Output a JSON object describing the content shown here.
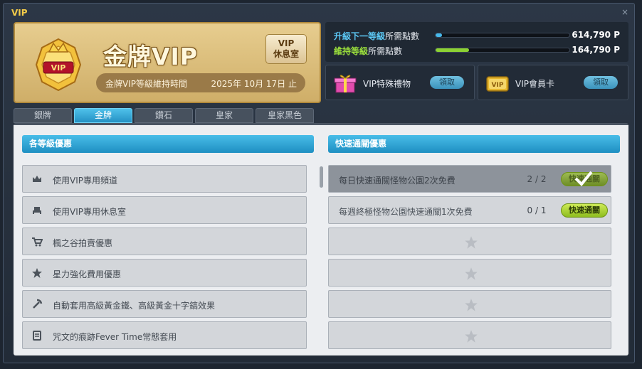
{
  "window": {
    "title": "VIP",
    "close_glyph": "×"
  },
  "card": {
    "title": "金牌VIP",
    "lounge_button": [
      "VIP",
      "休息室"
    ],
    "expire_label": "金牌VIP等級維持時間",
    "expire_date": "2025年 10月 17日 止"
  },
  "progress": [
    {
      "label_highlight": "升級下一等級",
      "label_rest": "所需點數",
      "value": "614,790 P",
      "fill_percent": 5,
      "highlight_color": "#5cc8f5",
      "fill_color": "#46b9ec"
    },
    {
      "label_highlight": "維持等級",
      "label_rest": "所需點數",
      "value": "164,790 P",
      "fill_percent": 25,
      "highlight_color": "#9be03c",
      "fill_color": "#8cd233"
    }
  ],
  "gifts": [
    {
      "label": "VIP特殊禮物",
      "button": "領取",
      "icon": "gift-box-icon"
    },
    {
      "label": "VIP會員卡",
      "button": "領取",
      "icon": "vip-card-icon"
    }
  ],
  "tabs": [
    "銀牌",
    "金牌",
    "鑽石",
    "皇家",
    "皇家黑色"
  ],
  "active_tab": 1,
  "left": {
    "header": "各等級優惠",
    "items": [
      {
        "label": "使用VIP專用頻道",
        "icon": "crown-icon"
      },
      {
        "label": "使用VIP專用休息室",
        "icon": "armchair-icon"
      },
      {
        "label": "楓之谷拍賣優惠",
        "icon": "cart-icon"
      },
      {
        "label": "星力強化費用優惠",
        "icon": "star-icon"
      },
      {
        "label": "自動套用高級黃金鐵、高級黃金十字鎬效果",
        "icon": "pickaxe-icon"
      },
      {
        "label": "咒文的痕跡Fever Time常態套用",
        "icon": "scroll-icon"
      }
    ]
  },
  "right": {
    "header": "快速通關優惠",
    "items": [
      {
        "label": "每日快速通關怪物公園2次免費",
        "count": "2 / 2",
        "button": "快速通關",
        "done": true
      },
      {
        "label": "每週終極怪物公園快速通關1次免費",
        "count": "0 / 1",
        "button": "快速通關",
        "done": false
      }
    ],
    "empty_slots": 4
  }
}
